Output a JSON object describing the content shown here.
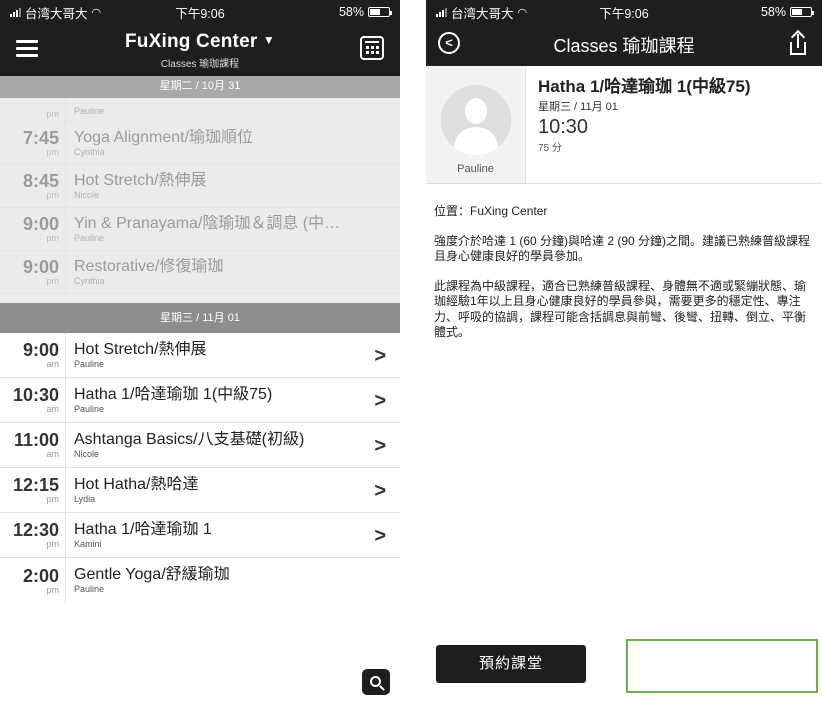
{
  "left": {
    "status": {
      "carrier": "台湾大哥大",
      "time": "下午9:06",
      "battery": "58%"
    },
    "header": {
      "title": "FuXing Center",
      "title_caret": "▼",
      "subtitle": "Classes 瑜珈課程"
    },
    "days": [
      {
        "label": "星期二 / 10月 31",
        "past": true,
        "classes": [
          {
            "time": "",
            "ampm": "pm",
            "name": "",
            "teacher": "Pauline"
          },
          {
            "time": "7:45",
            "ampm": "pm",
            "name": "Yoga Alignment/瑜珈順位",
            "teacher": "Cynthia"
          },
          {
            "time": "8:45",
            "ampm": "pm",
            "name": "Hot Stretch/熱伸展",
            "teacher": "Nicole"
          },
          {
            "time": "9:00",
            "ampm": "pm",
            "name": "Yin & Pranayama/陰瑜珈＆調息 (中…",
            "teacher": "Pauline"
          },
          {
            "time": "9:00",
            "ampm": "pm",
            "name": "Restorative/修復瑜珈",
            "teacher": "Cynthia"
          }
        ]
      },
      {
        "label": "星期三 / 11月 01",
        "past": false,
        "classes": [
          {
            "time": "9:00",
            "ampm": "am",
            "name": "Hot Stretch/熱伸展",
            "teacher": "Pauline"
          },
          {
            "time": "10:30",
            "ampm": "am",
            "name": "Hatha 1/哈達瑜珈 1(中級75)",
            "teacher": "Pauline"
          },
          {
            "time": "11:00",
            "ampm": "am",
            "name": "Ashtanga Basics/八支基礎(初級)",
            "teacher": "Nicole"
          },
          {
            "time": "12:15",
            "ampm": "pm",
            "name": "Hot Hatha/熱哈達",
            "teacher": "Lydia"
          },
          {
            "time": "12:30",
            "ampm": "pm",
            "name": "Hatha 1/哈達瑜珈 1",
            "teacher": "Kamini"
          },
          {
            "time": "2:00",
            "ampm": "pm",
            "name": "Gentle Yoga/舒緩瑜珈",
            "teacher": "Pauline"
          }
        ]
      }
    ],
    "chevron": ">"
  },
  "right": {
    "status": {
      "carrier": "台湾大哥大",
      "time": "下午9:06",
      "battery": "58%"
    },
    "header": {
      "back_glyph": "<",
      "title": "Classes 瑜珈課程"
    },
    "class": {
      "title": "Hatha 1/哈達瑜珈 1(中級75)",
      "date": "星期三 / 11月 01",
      "time": "10:30",
      "duration": "75 分",
      "teacher": "Pauline"
    },
    "location": "位置：FuXing Center",
    "paragraphs": [
      "強度介於哈達 1 (60 分鐘)與哈達 2 (90 分鐘)之間。建議已熟練普級課程且身心健康良好的學員參加。",
      "此課程為中級課程，適合已熟練普級課程、身體無不適或緊繃狀態、瑜珈經驗1年以上且身心健康良好的學員參與，需要更多的穩定性、專注力、呼吸的協調，課程可能含括調息與前彎、後彎、扭轉、倒立、平衡體式。"
    ],
    "book_button": "預約課堂"
  },
  "colors": {
    "dark": "#1e1e1e",
    "day_header": "#8d8d8d",
    "highlight": "#6ab04c"
  }
}
